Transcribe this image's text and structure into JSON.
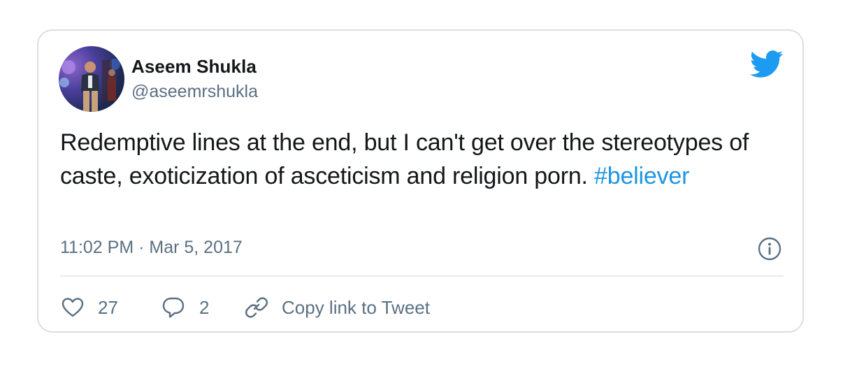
{
  "tweet": {
    "author_name": "Aseem Shukla",
    "author_handle": "@aseemrshukla",
    "text_main": "Redemptive lines at the end, but I can't get over the stereotypes of caste, exoticization of asceticism and religion porn. ",
    "hashtag": "#believer",
    "timestamp": "11:02 PM · Mar 5, 2017"
  },
  "actions": {
    "like_count": "27",
    "reply_count": "2",
    "copy_link_label": "Copy link to Tweet"
  },
  "icons": {
    "brand": "twitter-bird-icon",
    "info": "info-icon",
    "like": "heart-icon",
    "reply": "speech-bubble-icon",
    "copy": "link-icon"
  },
  "colors": {
    "accent": "#1b95e0",
    "text": "#141619",
    "muted": "#5b7083",
    "border": "#d9dfe4"
  }
}
